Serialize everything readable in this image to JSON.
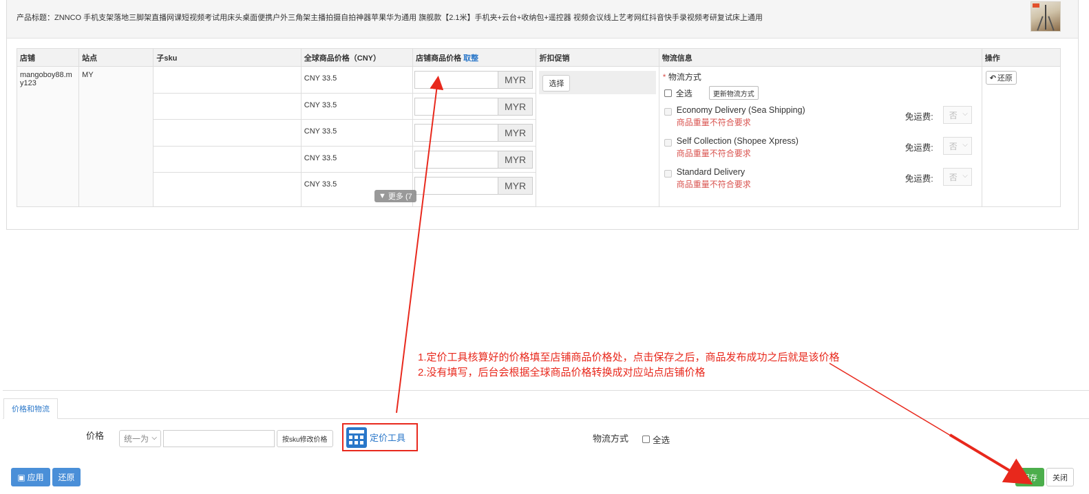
{
  "product": {
    "title": "产品标题：ZNNCO 手机支架落地三脚架直播网课短视频考试用床头桌面便携户外三角架主播拍摄自拍神器苹果华为通用 旗舰款【2.1米】手机夹+云台+收纳包+遥控器 视频会议线上艺考网红抖音快手录视频考研复试床上通用"
  },
  "table": {
    "headers": {
      "store": "店铺",
      "site": "站点",
      "sku": "子sku",
      "global_price": "全球商品价格（CNY）",
      "store_price": "店铺商品价格",
      "store_price_link": "取整",
      "discount": "折扣促销",
      "logistics": "物流信息",
      "actions": "操作"
    },
    "store": "mangoboy88.my123",
    "site": "MY",
    "rows": [
      {
        "cny": "CNY 33.5",
        "currency": "MYR"
      },
      {
        "cny": "CNY 33.5",
        "currency": "MYR"
      },
      {
        "cny": "CNY 33.5",
        "currency": "MYR"
      },
      {
        "cny": "CNY 33.5",
        "currency": "MYR"
      },
      {
        "cny": "CNY 33.5",
        "currency": "MYR"
      }
    ],
    "more_label": "更多 (7",
    "select_button": "选择",
    "restore_button": "还原",
    "logistics": {
      "required_mark": "*",
      "title": "物流方式",
      "select_all": "全选",
      "update_button": "更新物流方式",
      "free_label": "免运费:",
      "channels": [
        {
          "name": "Economy Delivery (Sea Shipping)",
          "error": "商品重量不符合要求",
          "free": "否"
        },
        {
          "name": "Self Collection (Shopee Xpress)",
          "error": "商品重量不符合要求",
          "free": "否"
        },
        {
          "name": "Standard Delivery",
          "error": "商品重量不符合要求",
          "free": "否"
        }
      ]
    }
  },
  "annotation": {
    "line1": "1.定价工具核算好的价格填至店铺商品价格处，点击保存之后，商品发布成功之后就是该价格",
    "line2": "2.没有填写，后台会根据全球商品价格转换成对应站点店铺价格",
    "color": "#e8281c"
  },
  "bottom": {
    "tab": "价格和物流",
    "price_label": "价格",
    "unify_select": "统一为",
    "by_sku_button": "按sku修改价格",
    "pricing_tool": "定价工具",
    "logistics_label": "物流方式",
    "select_all": "全选",
    "apply_button": "应用",
    "revert_button": "还原",
    "save_button": "保存",
    "close_button": "关闭"
  },
  "colors": {
    "link": "#2a77c9",
    "error": "#d9534f",
    "save": "#4cae4c",
    "primary": "#4a8fd8"
  }
}
